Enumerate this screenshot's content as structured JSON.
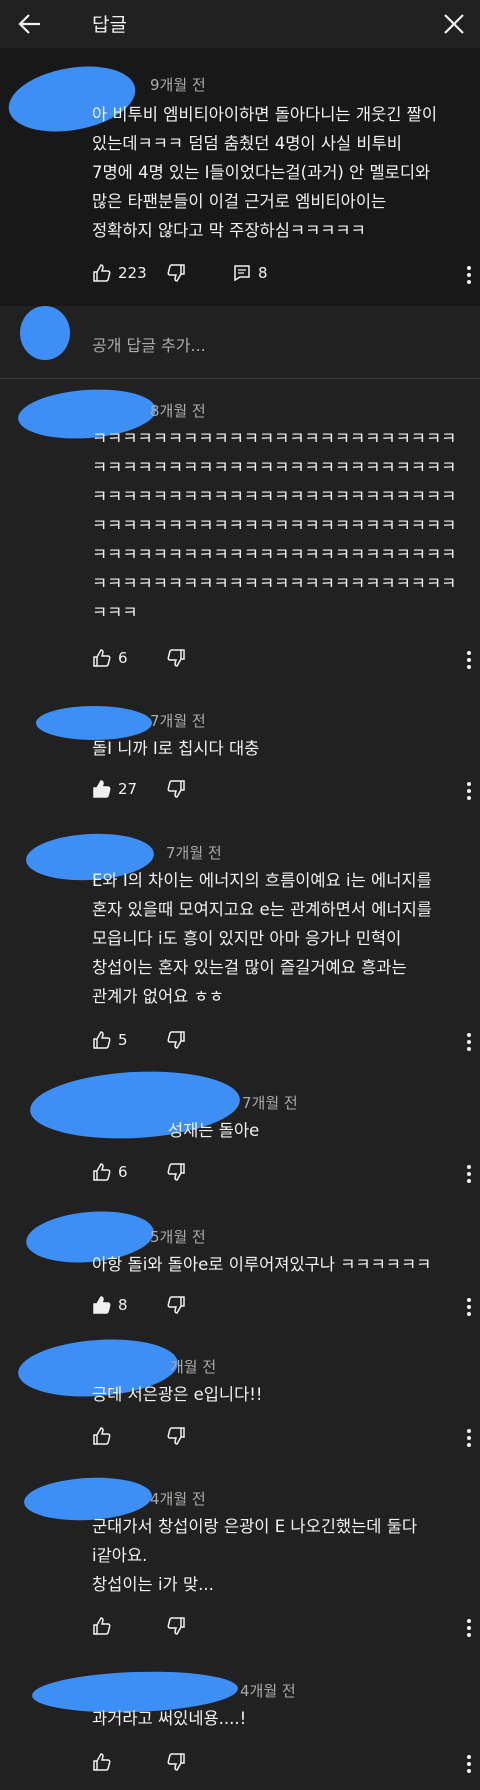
{
  "header": {
    "title": "답글"
  },
  "parent": {
    "time": "9개월 전",
    "text_lines": [
      "아 비투비 엠비티아이하면 돌아다니는 개웃긴 짤이",
      "있는데ㅋㅋㅋ 덤덤 춤췄던 4명이 사실 비투비",
      "7명에 4명 있는 I들이었다는걸(과거) 안 멜로디와",
      "많은 타팬분들이 이걸 근거로 엠비티아이는",
      "정확하지 않다고 막 주장하심ㅋㅋㅋㅋㅋ"
    ],
    "likes": "223",
    "replies": "8"
  },
  "reply_input": {
    "placeholder": "공개 답글 추가..."
  },
  "replies": [
    {
      "time": "8개월 전",
      "text_lines": [
        "ㅋㅋㅋㅋㅋㅋㅋㅋㅋㅋㅋㅋㅋㅋㅋㅋㅋㅋㅋㅋㅋㅋㅋㅋ",
        "ㅋㅋㅋㅋㅋㅋㅋㅋㅋㅋㅋㅋㅋㅋㅋㅋㅋㅋㅋㅋㅋㅋㅋㅋ",
        "ㅋㅋㅋㅋㅋㅋㅋㅋㅋㅋㅋㅋㅋㅋㅋㅋㅋㅋㅋㅋㅋㅋㅋㅋ",
        "ㅋㅋㅋㅋㅋㅋㅋㅋㅋㅋㅋㅋㅋㅋㅋㅋㅋㅋㅋㅋㅋㅋㅋㅋ",
        "ㅋㅋㅋㅋㅋㅋㅋㅋㅋㅋㅋㅋㅋㅋㅋㅋㅋㅋㅋㅋㅋㅋㅋㅋ",
        "ㅋㅋㅋㅋㅋㅋㅋㅋㅋㅋㅋㅋㅋㅋㅋㅋㅋㅋㅋㅋㅋㅋㅋㅋ",
        "ㅋㅋㅋ"
      ],
      "likes": "6",
      "liked": false
    },
    {
      "time": "7개월 전",
      "text_lines": [
        "돌I 니까 I로 칩시다 대충"
      ],
      "likes": "27",
      "liked": true
    },
    {
      "time": "7개월 전",
      "text_lines": [
        "E와 I의 차이는 에너지의 흐름이예요 i는 에너지를",
        "혼자 있을때 모여지고요  e는 관계하면서 에너지를",
        "모읍니다 i도 흥이 있지만 아마 응가나 민혁이",
        "창섭이는 혼자 있는걸 많이 즐길거예요 흥과는",
        "관계가 없어요 ㅎㅎ"
      ],
      "likes": "5",
      "liked": false
    },
    {
      "time": "7개월 전",
      "text_lines": [
        "성재는 돌아e"
      ],
      "likes": "6",
      "liked": false
    },
    {
      "time": "5개월 전",
      "text_lines": [
        "아항 돌i와 돌아e로 이루어져있구나 ㅋㅋㅋㅋㅋㅋ"
      ],
      "likes": "8",
      "liked": true
    },
    {
      "time": "개월 전",
      "text_lines": [
        "긍데 서은광은 e입니다!!"
      ],
      "likes": "",
      "liked": false
    },
    {
      "time": "4개월 전",
      "text_lines": [
        "군대가서 창섭이랑 은광이 E 나오긴했는데 둘다",
        "i같아요.",
        "창섭이는 i가 맞..."
      ],
      "likes": "",
      "liked": false
    },
    {
      "time": "4개월 전",
      "text_lines": [
        "과거라고 써있네용....!"
      ],
      "likes": "",
      "liked": false
    }
  ],
  "colors": {
    "background": "#212121",
    "parent_bg": "#181818",
    "blob": "#3d8ff5",
    "meta": "#aaaaaa"
  },
  "icons": [
    "back-arrow-icon",
    "close-icon",
    "thumb-up-icon",
    "thumb-down-icon",
    "reply-icon",
    "more-vert-icon"
  ]
}
